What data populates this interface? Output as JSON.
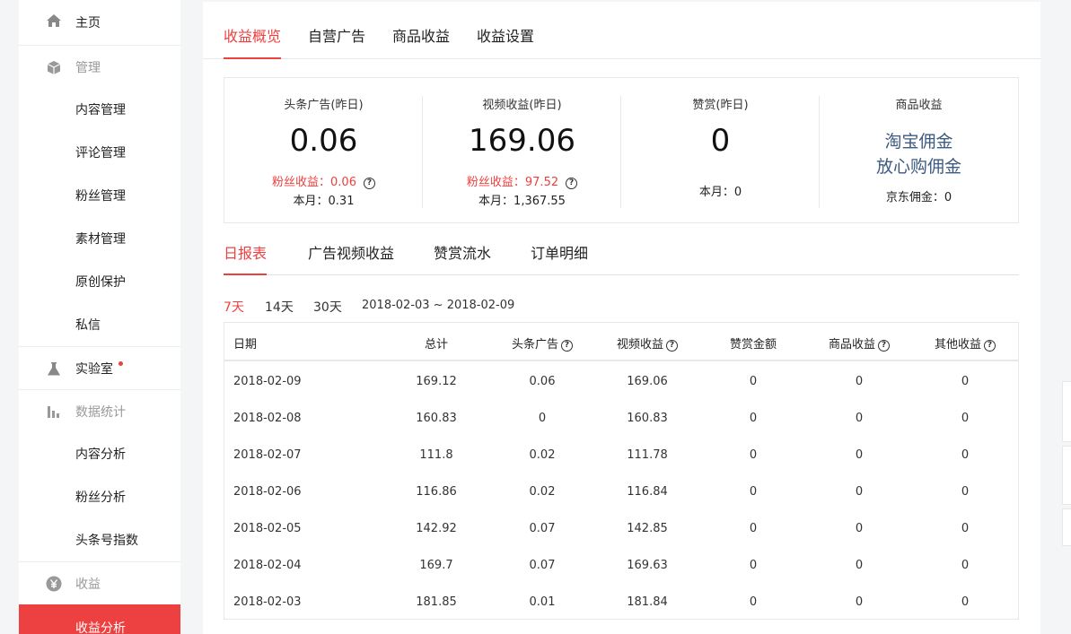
{
  "sidebar": {
    "home": "主页",
    "manage": "管理",
    "manage_items": [
      "内容管理",
      "评论管理",
      "粉丝管理",
      "素材管理",
      "原创保护",
      "私信"
    ],
    "lab": "实验室",
    "stats": "数据统计",
    "stats_items": [
      "内容分析",
      "粉丝分析",
      "头条号指数"
    ],
    "income": "收益",
    "income_items": [
      "收益分析"
    ]
  },
  "top_tabs": [
    "收益概览",
    "自营广告",
    "商品收益",
    "收益设置"
  ],
  "summary": {
    "toutiao_ad": {
      "title": "头条广告(昨日)",
      "value": "0.06",
      "fans": "粉丝收益：0.06",
      "month": "本月：0.31"
    },
    "video": {
      "title": "视频收益(昨日)",
      "value": "169.06",
      "fans": "粉丝收益：97.52",
      "month": "本月：1,367.55"
    },
    "reward": {
      "title": "赞赏(昨日)",
      "value": "0",
      "month": "本月：0"
    },
    "goods": {
      "title": "商品收益",
      "link1": "淘宝佣金",
      "link2": "放心购佣金",
      "jd": "京东佣金：0"
    }
  },
  "sub_tabs": [
    "日报表",
    "广告视频收益",
    "赞赏流水",
    "订单明细"
  ],
  "ranges": [
    "7天",
    "14天",
    "30天"
  ],
  "date_range": "2018-02-03 ~ 2018-02-09",
  "table": {
    "headers": [
      "日期",
      "总计",
      "头条广告",
      "视频收益",
      "赞赏金额",
      "商品收益",
      "其他收益"
    ],
    "rows": [
      [
        "2018-02-09",
        "169.12",
        "0.06",
        "169.06",
        "0",
        "0",
        "0"
      ],
      [
        "2018-02-08",
        "160.83",
        "0",
        "160.83",
        "0",
        "0",
        "0"
      ],
      [
        "2018-02-07",
        "111.8",
        "0.02",
        "111.78",
        "0",
        "0",
        "0"
      ],
      [
        "2018-02-06",
        "116.86",
        "0.02",
        "116.84",
        "0",
        "0",
        "0"
      ],
      [
        "2018-02-05",
        "142.92",
        "0.07",
        "142.85",
        "0",
        "0",
        "0"
      ],
      [
        "2018-02-04",
        "169.7",
        "0.07",
        "169.63",
        "0",
        "0",
        "0"
      ],
      [
        "2018-02-03",
        "181.85",
        "0.01",
        "181.84",
        "0",
        "0",
        "0"
      ]
    ]
  }
}
